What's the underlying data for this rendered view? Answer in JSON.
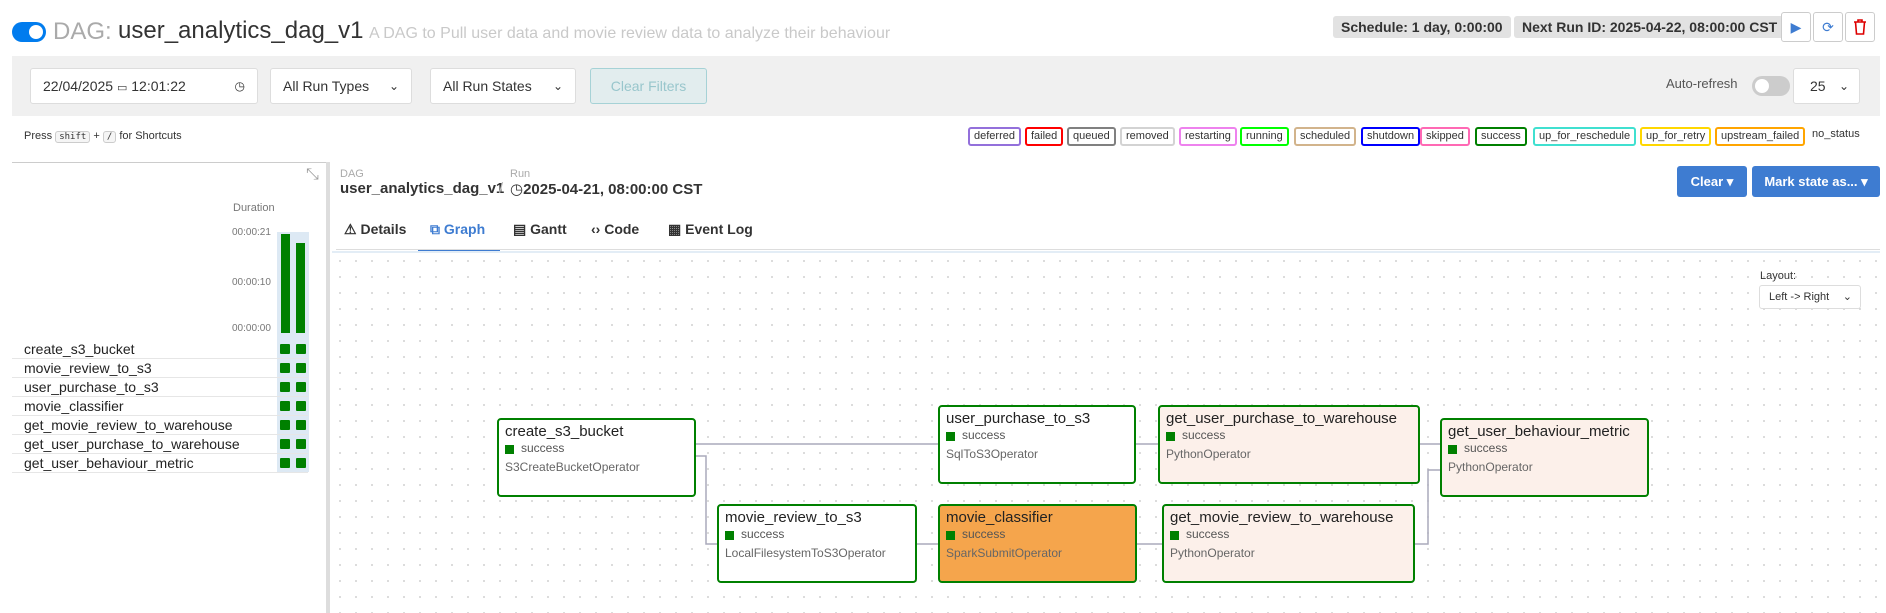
{
  "header": {
    "dag_label": "DAG:",
    "dag_id": "user_analytics_dag_v1",
    "description": "A DAG to Pull user data and movie review data to analyze their behaviour",
    "schedule": "Schedule: 1 day, 0:00:00",
    "next_run": "Next Run ID: 2025-04-22, 08:00:00 CST"
  },
  "filters": {
    "date": "22/04/2025",
    "time": "12:01:22",
    "run_types": "All Run Types",
    "run_states": "All Run States",
    "clear": "Clear Filters",
    "auto_refresh": "Auto-refresh",
    "page_size": "25"
  },
  "shortcuts": {
    "press": "Press",
    "key1": "shift",
    "plus": "+",
    "key2": "/",
    "suffix": "for Shortcuts"
  },
  "legend": [
    {
      "label": "deferred",
      "color": "#9370db"
    },
    {
      "label": "failed",
      "color": "#ff0000"
    },
    {
      "label": "queued",
      "color": "#808080"
    },
    {
      "label": "removed",
      "color": "#d3d3d3"
    },
    {
      "label": "restarting",
      "color": "#ee82ee"
    },
    {
      "label": "running",
      "color": "#00ff00"
    },
    {
      "label": "scheduled",
      "color": "#d2b48c"
    },
    {
      "label": "shutdown",
      "color": "#0000ff"
    },
    {
      "label": "skipped",
      "color": "#ff69b4"
    },
    {
      "label": "success",
      "color": "#008000"
    },
    {
      "label": "up_for_reschedule",
      "color": "#40e0d0"
    },
    {
      "label": "up_for_retry",
      "color": "#ffd700"
    },
    {
      "label": "upstream_failed",
      "color": "#ffa500"
    },
    {
      "label": "no_status",
      "color": "none"
    }
  ],
  "grid": {
    "duration_title": "Duration",
    "ticks": [
      "00:00:21",
      "00:00:10",
      "00:00:00"
    ],
    "run_durations": [
      21,
      19
    ],
    "tasks": [
      "create_s3_bucket",
      "movie_review_to_s3",
      "user_purchase_to_s3",
      "movie_classifier",
      "get_movie_review_to_warehouse",
      "get_user_purchase_to_warehouse",
      "get_user_behaviour_metric"
    ]
  },
  "details": {
    "dag_label": "DAG",
    "dag_value": "user_analytics_dag_v1",
    "sep": "/",
    "run_label": "Run",
    "run_value": "2025-04-21, 08:00:00 CST",
    "clear_btn": "Clear ▾",
    "mark_btn": "Mark state as... ▾",
    "tabs": [
      "Details",
      "Graph",
      "Gantt",
      "Code",
      "Event Log"
    ]
  },
  "graph": {
    "layout_label": "Layout:",
    "layout_value": "Left -> Right",
    "nodes": [
      {
        "id": "create_s3_bucket",
        "state": "success",
        "operator": "S3CreateBucketOperator"
      },
      {
        "id": "user_purchase_to_s3",
        "state": "success",
        "operator": "SqlToS3Operator"
      },
      {
        "id": "get_user_purchase_to_warehouse",
        "state": "success",
        "operator": "PythonOperator"
      },
      {
        "id": "get_user_behaviour_metric",
        "state": "success",
        "operator": "PythonOperator"
      },
      {
        "id": "movie_review_to_s3",
        "state": "success",
        "operator": "LocalFilesystemToS3Operator"
      },
      {
        "id": "movie_classifier",
        "state": "success",
        "operator": "SparkSubmitOperator"
      },
      {
        "id": "get_movie_review_to_warehouse",
        "state": "success",
        "operator": "PythonOperator"
      }
    ]
  }
}
